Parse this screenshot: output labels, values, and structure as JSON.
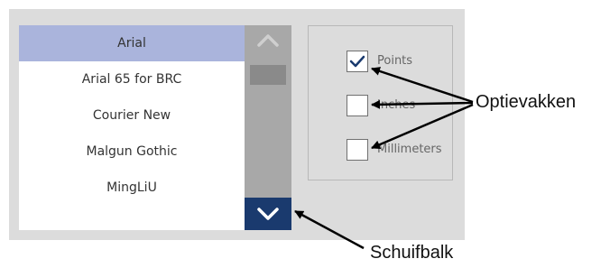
{
  "font_list": {
    "items": [
      {
        "label": "Arial",
        "selected": true
      },
      {
        "label": "Arial 65 for BRC",
        "selected": false
      },
      {
        "label": "Courier New",
        "selected": false
      },
      {
        "label": "Malgun Gothic",
        "selected": false
      },
      {
        "label": "MingLiU",
        "selected": false
      }
    ],
    "selected_bg": "#aab4dc"
  },
  "scrollbar": {
    "up_icon": "chevron-up-icon",
    "down_icon": "chevron-down-icon",
    "down_button_color": "#1a3a6e"
  },
  "units": {
    "options": [
      {
        "label": "Points",
        "checked": true
      },
      {
        "label": "Inches",
        "checked": false
      },
      {
        "label": "Millimeters",
        "checked": false
      }
    ]
  },
  "callouts": {
    "checkboxes_label": "Optievakken",
    "scrollbar_label": "Schuifbalk"
  }
}
